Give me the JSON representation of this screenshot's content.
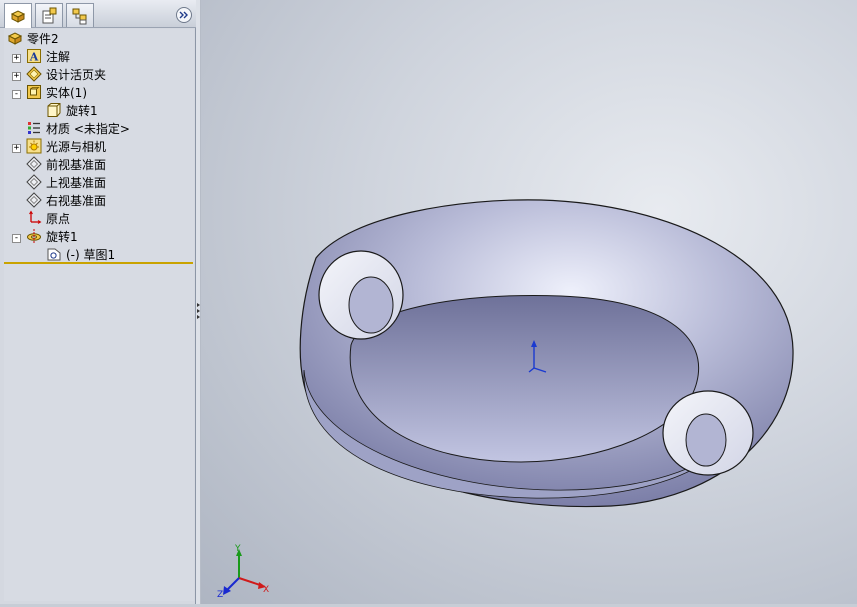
{
  "tabs": [
    {
      "name": "feature-manager",
      "icon": "feature-manager-icon"
    },
    {
      "name": "property-manager",
      "icon": "property-manager-icon"
    },
    {
      "name": "configuration-manager",
      "icon": "configuration-manager-icon"
    }
  ],
  "tree": {
    "root": "零件2",
    "items": [
      {
        "label": "注解",
        "icon": "annotation-icon",
        "expander": "+"
      },
      {
        "label": "设计活页夹",
        "icon": "design-binder-icon",
        "expander": "+"
      },
      {
        "label": "实体(1)",
        "icon": "solid-bodies-icon",
        "expander": "-"
      },
      {
        "label": "旋转1",
        "icon": "body-icon",
        "expander": ""
      },
      {
        "label": "材质 <未指定>",
        "icon": "material-icon",
        "expander": ""
      },
      {
        "label": "光源与相机",
        "icon": "lights-camera-icon",
        "expander": "+"
      },
      {
        "label": "前视基准面",
        "icon": "plane-icon",
        "expander": ""
      },
      {
        "label": "上视基准面",
        "icon": "plane-icon",
        "expander": ""
      },
      {
        "label": "右视基准面",
        "icon": "plane-icon",
        "expander": ""
      },
      {
        "label": "原点",
        "icon": "origin-icon",
        "expander": ""
      },
      {
        "label": "旋转1",
        "icon": "revolve-feature-icon",
        "expander": "-"
      },
      {
        "label": "(-) 草图1",
        "icon": "sketch-icon",
        "expander": ""
      }
    ]
  },
  "triad": {
    "x": "X",
    "y": "Y",
    "z": "Z"
  },
  "colors": {
    "accent": "#c9a300",
    "model": "#b9bcd8",
    "panel": "#d7dbe3"
  }
}
